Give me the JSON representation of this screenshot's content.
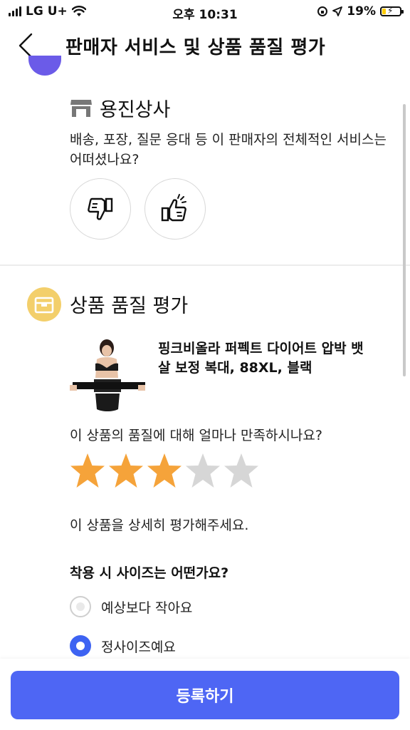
{
  "status_bar": {
    "carrier": "LG U+",
    "time": "오후 10:31",
    "battery_percent": "19%"
  },
  "header": {
    "title": "판매자 서비스 및 상품 품질 평가"
  },
  "seller": {
    "name": "용진상사",
    "question": "배송, 포장, 질문 응대 등 이 판매자의 전체적인 서비스는 어떠셨나요?"
  },
  "quality": {
    "title": "상품 품질 평가",
    "product_name": "핑크비올라 퍼펙트 다이어트 압박 뱃살 보정 복대, 88XL, 블랙",
    "satisfaction_question": "이 상품의 품질에 대해 얼마나 만족하시나요?",
    "rating": 3,
    "max_rating": 5,
    "detail_prompt": "이 상품을 상세히 평가해주세요.",
    "size_question": "착용 시 사이즈는 어떤가요?",
    "size_options": [
      {
        "label": "예상보다 작아요",
        "selected": false
      },
      {
        "label": "정사이즈예요",
        "selected": true
      }
    ]
  },
  "footer": {
    "submit_label": "등록하기"
  },
  "colors": {
    "accent": "#4e66f4",
    "star_on": "#f5a33a",
    "star_off": "#d6d6d6",
    "quality_icon_bg": "#f3cf6b"
  }
}
